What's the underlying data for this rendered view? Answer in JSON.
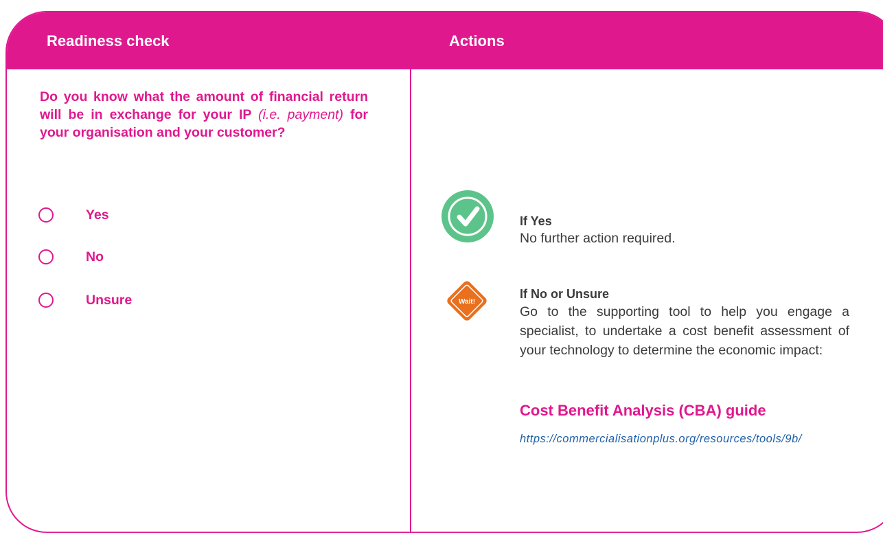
{
  "header": {
    "left_title": "Readiness check",
    "right_title": "Actions"
  },
  "question": {
    "part1": "Do you know what the amount of financial return will be in exchange for your IP ",
    "italic": "(i.e. payment)",
    "part2": " for your organisation and your customer?"
  },
  "options": [
    "Yes",
    "No",
    "Unsure"
  ],
  "actions": {
    "yes": {
      "icon": "check-icon",
      "title": "If Yes",
      "text": "No further action required."
    },
    "no": {
      "icon": "wait-diamond-icon",
      "badge": "Wait!",
      "title": "If No or Unsure",
      "text": "Go to the supporting tool to help you engage a specialist, to undertake a cost benefit assessment of your technology to determine the economic impact:"
    },
    "link": {
      "title": "Cost Benefit Analysis (CBA) guide",
      "url": "https://commercialisationplus.org/resources/tools/9b/"
    }
  },
  "colors": {
    "brand": "#e0188e",
    "check_green": "#5cc48a",
    "wait_orange": "#e8701e",
    "link_blue": "#1f5fa8"
  }
}
